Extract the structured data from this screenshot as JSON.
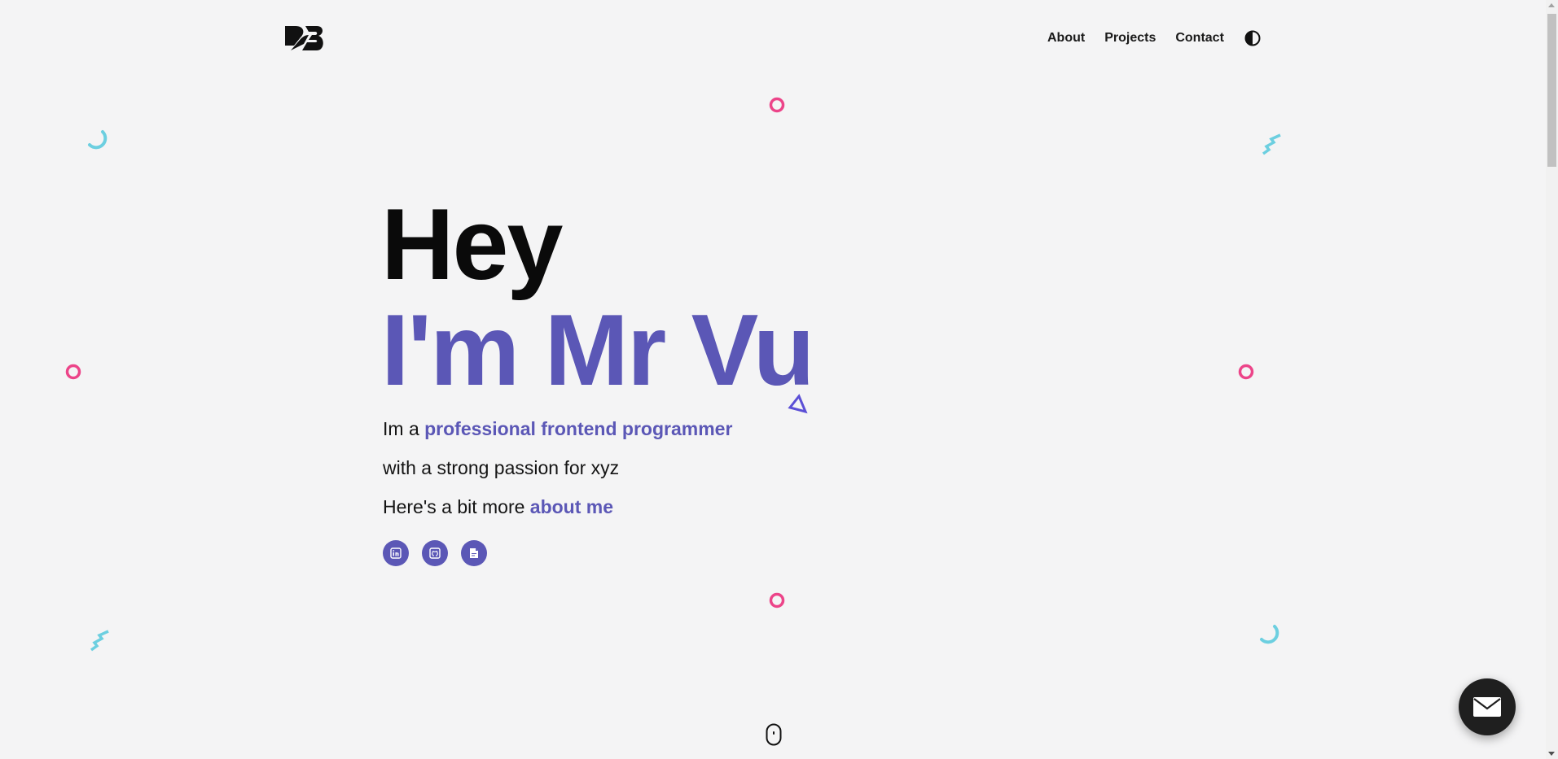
{
  "header": {
    "logo": "DB",
    "nav": [
      {
        "label": "About"
      },
      {
        "label": "Projects"
      },
      {
        "label": "Contact"
      }
    ],
    "theme_toggle_icon": "contrast-icon"
  },
  "hero": {
    "greeting": "Hey",
    "name": "I'm Mr Vu",
    "line1_prefix": "Im a",
    "line1_accent": "professional frontend programmer",
    "line2": "with a strong passion for xyz",
    "line3_prefix": "Here's a bit more",
    "line3_link": "about me"
  },
  "socials": [
    {
      "icon": "linkedin-icon"
    },
    {
      "icon": "github-icon"
    },
    {
      "icon": "resume-file-icon"
    }
  ],
  "colors": {
    "accent": "#5b57b6",
    "pink": "#ec4489",
    "teal": "#6ccfe0",
    "background": "#f4f4f5"
  },
  "fab": {
    "icon": "mail-icon"
  }
}
